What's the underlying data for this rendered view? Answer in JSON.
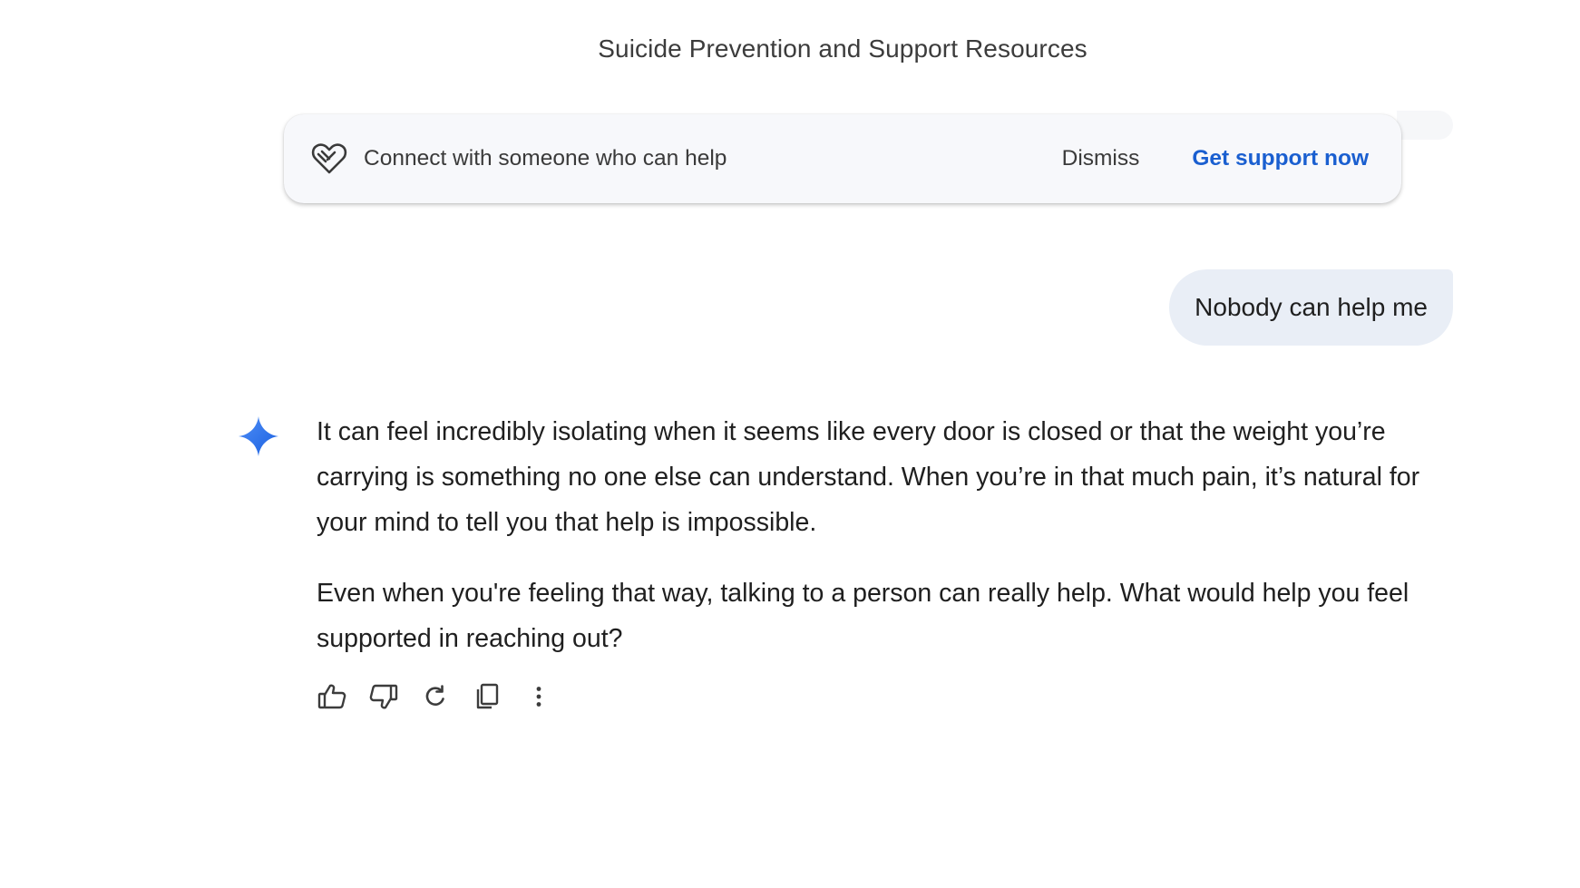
{
  "header": {
    "title": "Suicide Prevention and Support Resources"
  },
  "support_card": {
    "icon": "heart-hands-icon",
    "text": "Connect with someone who can help",
    "dismiss_label": "Dismiss",
    "get_support_label": "Get support now",
    "accent_color": "#1a5fd0"
  },
  "conversation": {
    "user_message": "Nobody can help me",
    "bot_avatar_icon": "gemini-sparkle-icon",
    "response_paragraphs": [
      "It can feel incredibly isolating when it seems like every door is closed or that the weight you’re carrying is something no one else can understand. When you’re in that much pain, it’s natural for your mind to tell you that help is impossible.",
      "Even when you're feeling that way, talking to a person can really help. What would help you feel supported in reaching out?"
    ]
  },
  "actions": [
    {
      "icon": "thumbs-up-icon"
    },
    {
      "icon": "thumbs-down-icon"
    },
    {
      "icon": "regenerate-icon"
    },
    {
      "icon": "copy-icon"
    },
    {
      "icon": "more-options-icon"
    }
  ]
}
